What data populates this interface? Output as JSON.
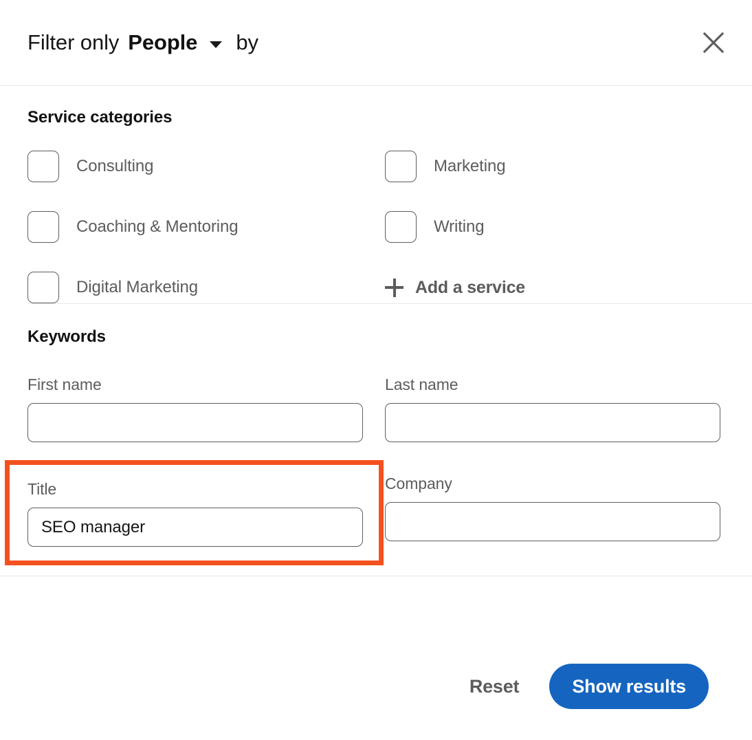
{
  "header": {
    "prefix_label": "Filter only",
    "entity_label": "People",
    "suffix_label": "by",
    "dropdown_icon": "chevron-down-icon",
    "close_icon": "close-icon"
  },
  "service_categories": {
    "title": "Service categories",
    "options": [
      {
        "label": "Consulting",
        "checked": false
      },
      {
        "label": "Marketing",
        "checked": false
      },
      {
        "label": "Coaching & Mentoring",
        "checked": false
      },
      {
        "label": "Writing",
        "checked": false
      },
      {
        "label": "Digital Marketing",
        "checked": false
      }
    ],
    "add_service": {
      "label": "Add a service",
      "icon": "plus-icon"
    }
  },
  "keywords": {
    "title": "Keywords",
    "fields": [
      {
        "label": "First name",
        "value": "",
        "placeholder": "",
        "highlighted": false
      },
      {
        "label": "Last name",
        "value": "",
        "placeholder": "",
        "highlighted": false
      },
      {
        "label": "Title",
        "value": "SEO manager",
        "placeholder": "",
        "highlighted": true
      },
      {
        "label": "Company",
        "value": "",
        "placeholder": "",
        "highlighted": false
      }
    ]
  },
  "footer": {
    "reset_label": "Reset",
    "show_results_label": "Show results"
  },
  "colors": {
    "primary_blue": "#1565c0",
    "highlight_orange": "#f4511e",
    "border_gray": "#5e5e5e",
    "text_gray": "#5c5c5c",
    "divider": "#e8e8e8"
  }
}
